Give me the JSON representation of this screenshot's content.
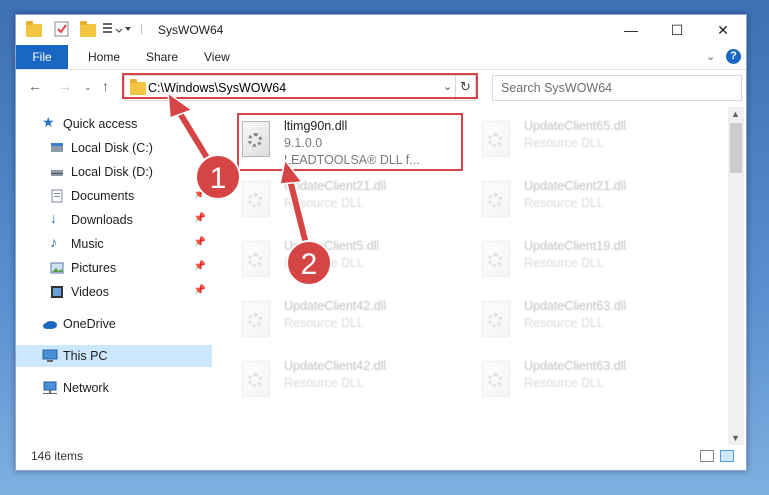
{
  "window": {
    "title": "SysWOW64",
    "controls": {
      "minimize": "—",
      "maximize": "☐",
      "close": "✕"
    }
  },
  "ribbon": {
    "tabs": [
      "File",
      "Home",
      "Share",
      "View"
    ],
    "expand_icon": "chevron-down-icon",
    "help_icon": "help-icon"
  },
  "nav": {
    "address": "C:\\Windows\\SysWOW64",
    "search_placeholder": "Search SysWOW64"
  },
  "sidebar": {
    "items": [
      {
        "label": "Quick access",
        "icon": "star-icon"
      },
      {
        "label": "Local Disk (C:)",
        "icon": "drive-icon"
      },
      {
        "label": "Local Disk (D:)",
        "icon": "drive-icon"
      },
      {
        "label": "Documents",
        "icon": "documents-icon"
      },
      {
        "label": "Downloads",
        "icon": "downloads-icon"
      },
      {
        "label": "Music",
        "icon": "music-icon"
      },
      {
        "label": "Pictures",
        "icon": "pictures-icon"
      },
      {
        "label": "Videos",
        "icon": "videos-icon"
      },
      {
        "label": "OneDrive",
        "icon": "cloud-icon"
      },
      {
        "label": "This PC",
        "icon": "computer-icon"
      },
      {
        "label": "Network",
        "icon": "network-icon"
      }
    ]
  },
  "files": [
    {
      "name": "ltimg90n.dll",
      "line2": "9.1.0.0",
      "line3": "LEADTOOLSA® DLL f..."
    },
    {
      "name": "UpdateClient65.dll",
      "line2": "Resource DLL"
    },
    {
      "name": "UpdateClient21.dll",
      "line2": "Resource DLL"
    },
    {
      "name": "UpdateClient21.dll",
      "line2": "Resource DLL"
    },
    {
      "name": "UpdateClient5.dll",
      "line2": "Resource DLL"
    },
    {
      "name": "UpdateClient19.dll",
      "line2": "Resource DLL"
    },
    {
      "name": "UpdateClient42.dll",
      "line2": "Resource DLL"
    },
    {
      "name": "UpdateClient63.dll",
      "line2": "Resource DLL"
    },
    {
      "name": "UpdateClient42.dll",
      "line2": "Resource DLL"
    },
    {
      "name": "UpdateClient63.dll",
      "line2": "Resource DLL"
    }
  ],
  "status": {
    "count": "146 items"
  },
  "annotations": {
    "step1": "1",
    "step2": "2",
    "color": "#d64545"
  }
}
